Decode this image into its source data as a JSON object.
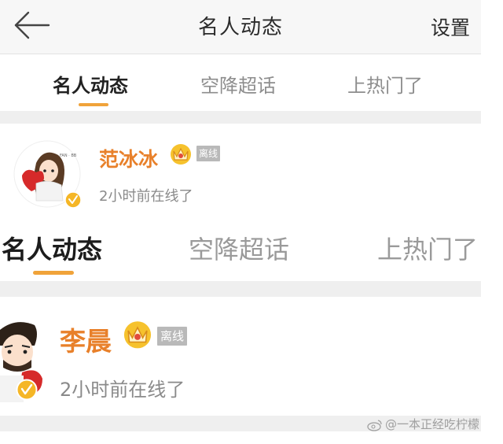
{
  "navbar": {
    "back_icon": "back-arrow-icon",
    "title": "名人动态",
    "settings_label": "设置"
  },
  "tabs_top": [
    {
      "label": "名人动态",
      "active": true
    },
    {
      "label": "空降超话",
      "active": false
    },
    {
      "label": "上热门了",
      "active": false
    }
  ],
  "users": [
    {
      "name": "范冰冰",
      "crown_icon": "crown-icon",
      "badge": "离线",
      "status": "2小时前在线了",
      "verified_icon": "verified-v-icon"
    },
    {
      "name": "李晨",
      "crown_icon": "crown-icon",
      "badge": "离线",
      "status": "2小时前在线了",
      "verified_icon": "verified-v-icon"
    }
  ],
  "tabs_zoomed": [
    {
      "label": "名人动态",
      "active": true
    },
    {
      "label": "空降超话",
      "active": false
    },
    {
      "label": "上热门了",
      "active": false
    }
  ],
  "watermark": "@一本正经吃柠檬",
  "colors": {
    "accent": "#f0a33a",
    "name": "#e8802a",
    "badge_bg": "#b9b9b9",
    "separator": "#efefef"
  }
}
